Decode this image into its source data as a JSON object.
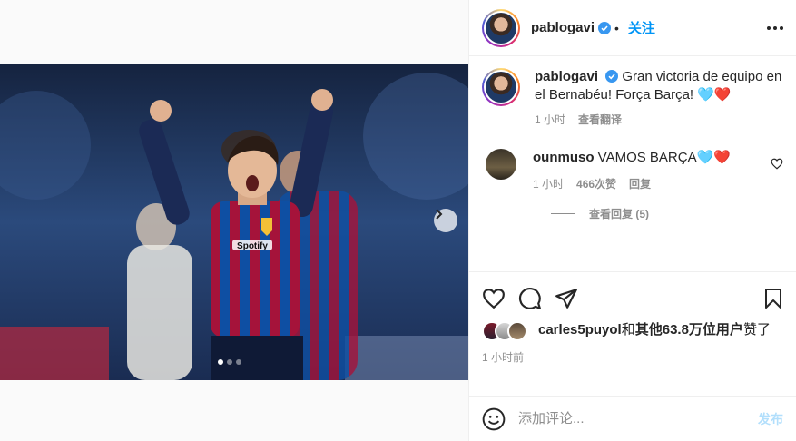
{
  "post": {
    "author": "pablogavi",
    "follow_label": "关注",
    "separator": "•",
    "caption": "Gran victoria de equipo en el Bernabéu! Força Barça! 🩵❤️",
    "caption_time": "1 小时",
    "translate_label": "查看翻译",
    "photo_sponsor": "Spotify",
    "carousel": {
      "total": 3,
      "active": 0
    }
  },
  "comments": [
    {
      "user": "ounmuso",
      "text": "VAMOS BARÇA🩵❤️",
      "time": "1 小时",
      "likes": "466次赞",
      "reply_label": "回复",
      "view_replies": "查看回复 (5)"
    }
  ],
  "likes": {
    "user": "carles5puyol",
    "connector": "和",
    "others": "其他63.8万位用户",
    "suffix": "赞了"
  },
  "timestamp": "1 小时前",
  "composer": {
    "placeholder": "添加评论...",
    "post_label": "发布"
  },
  "icons": [
    "more-options-icon",
    "verified-badge-icon",
    "heart-icon",
    "comment-icon",
    "share-icon",
    "bookmark-icon",
    "emoji-icon",
    "chevron-right-icon"
  ],
  "colors": {
    "accent": "#0095f6",
    "post_disabled": "#b2dffc",
    "like_red": "#ed4956",
    "verified": "#3897f0"
  }
}
